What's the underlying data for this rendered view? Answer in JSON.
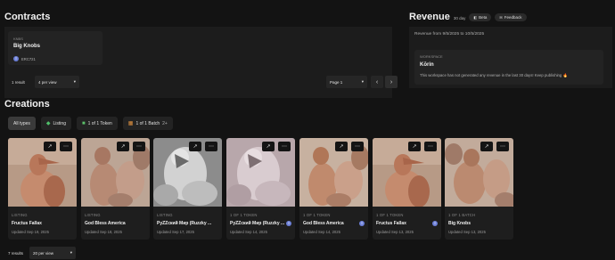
{
  "contracts": {
    "title": "Contracts",
    "card": {
      "kind": "KNBS",
      "name": "Big Knobs",
      "standard": "ERC721"
    },
    "result_count": "1 result",
    "per_view": "4 per view",
    "page": "Page 1"
  },
  "revenue": {
    "title": "Revenue",
    "period": "30 day",
    "beta_label": "Beta",
    "feedback_label": "Feedback",
    "range": "Revenue from 9/5/2025 to 10/5/2025",
    "workspace_label": "WORKSPACE",
    "workspace_name": "Kōrin",
    "message": "This workspace has not generated any revenue in the last 30 days! Keep publishing 🔥"
  },
  "creations": {
    "title": "Creations",
    "filters": [
      {
        "label": "All types"
      },
      {
        "label": "Listing"
      },
      {
        "label": "1 of 1 Token"
      },
      {
        "label": "1 of 1 Batch",
        "extra": "2+"
      }
    ],
    "tiles": [
      {
        "kind": "LISTING",
        "name": "Fructus Fallax",
        "updated": "Updated Sep 19, 2025"
      },
      {
        "kind": "LISTING",
        "name": "God Bless America",
        "updated": "Updated Sep 18, 2025"
      },
      {
        "kind": "LISTING",
        "name": "PyZZский Мир (Ruzzky ...",
        "updated": "Updated Sep 17, 2025"
      },
      {
        "kind": "1 OF 1 TOKEN",
        "name": "PyZZский Мир (Ruzzky ...",
        "updated": "Updated Sep 14, 2025"
      },
      {
        "kind": "1 OF 1 TOKEN",
        "name": "God Bless America",
        "updated": "Updated Sep 14, 2025"
      },
      {
        "kind": "1 OF 1 TOKEN",
        "name": "Fructus Fallax",
        "updated": "Updated Sep 13, 2025"
      },
      {
        "kind": "1 OF 1 BATCH",
        "name": "Big Knobs",
        "updated": "Updated Sep 13, 2025"
      }
    ],
    "result_count": "7 results",
    "per_view": "20 per view"
  },
  "icons": {
    "external": "↗",
    "more": "⋯",
    "prev": "‹",
    "next": "›",
    "caret": "▾",
    "eth": "Ξ"
  },
  "colors": {
    "background": "#131313",
    "panel": "#1c1c1c",
    "eth": "#6c7fd8"
  }
}
